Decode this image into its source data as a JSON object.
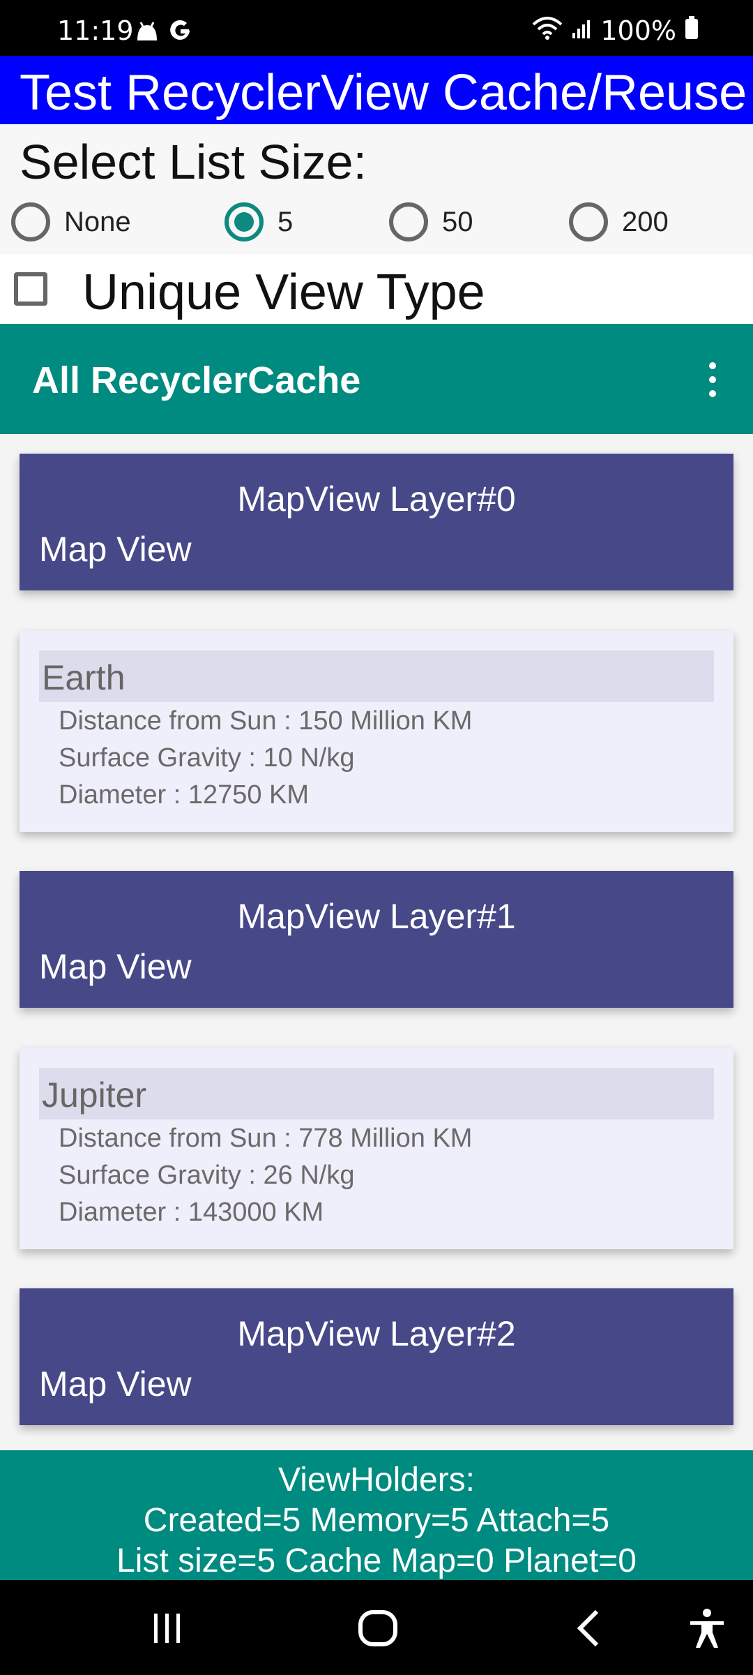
{
  "status_bar": {
    "time": "11:19",
    "battery_text": "100%",
    "left_icons": [
      "android-icon",
      "google-icon"
    ],
    "right_icons": [
      "wifi-icon",
      "signal-icon",
      "battery-icon"
    ]
  },
  "app": {
    "title": "Test RecyclerView Cache/Reuse"
  },
  "list_size": {
    "label": "Select List Size:",
    "options": [
      {
        "label": "None",
        "selected": false
      },
      {
        "label": "5",
        "selected": true
      },
      {
        "label": "50",
        "selected": false
      },
      {
        "label": "200",
        "selected": false
      }
    ]
  },
  "unique_view_type": {
    "label": "Unique View Type",
    "checked": false
  },
  "toolbar": {
    "title": "All RecyclerCache",
    "menu_icon": "overflow-menu-icon"
  },
  "list": {
    "map_cards": [
      {
        "layer": "MapView Layer#0",
        "view": "Map View"
      },
      {
        "layer": "MapView Layer#1",
        "view": "Map View"
      },
      {
        "layer": "MapView Layer#2",
        "view": "Map View"
      }
    ],
    "planets": [
      {
        "name": "Earth",
        "distance": "Distance from Sun : 150 Million KM",
        "gravity": "Surface Gravity : 10 N/kg",
        "diameter": "Diameter : 12750 KM"
      },
      {
        "name": "Jupiter",
        "distance": "Distance from Sun : 778 Million KM",
        "gravity": "Surface Gravity : 26 N/kg",
        "diameter": "Diameter : 143000 KM"
      }
    ]
  },
  "footer": {
    "line1": "ViewHolders:",
    "line2": "Created=5 Memory=5 Attach=5",
    "line3": "List size=5 Cache Map=0 Planet=0"
  },
  "nav_bar": {
    "buttons": [
      "recent-apps-icon",
      "home-icon",
      "back-icon",
      "accessibility-icon"
    ]
  },
  "colors": {
    "title_bar": "#0000ff",
    "accent": "#008b80",
    "map_card": "#464888",
    "planet_card": "#efeffb"
  }
}
